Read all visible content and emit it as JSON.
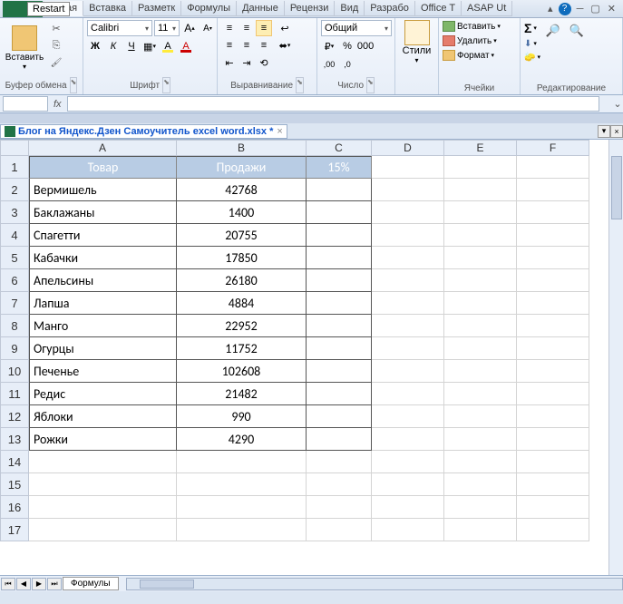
{
  "restart": "Restart",
  "tabs": [
    "авная",
    "Вставка",
    "Разметк",
    "Формулы",
    "Данные",
    "Рецензи",
    "Вид",
    "Разрабо",
    "Office T",
    "ASAP Ut"
  ],
  "ribbon": {
    "clipboard": {
      "paste": "Вставить",
      "label": "Буфер обмена"
    },
    "font": {
      "name": "Calibri",
      "size": "11",
      "label": "Шрифт",
      "bold": "Ж",
      "italic": "К",
      "underline": "Ч",
      "grow": "A",
      "shrink": "A"
    },
    "align": {
      "label": "Выравнивание",
      "wrap": "≡",
      "merge": "⬌"
    },
    "number": {
      "format": "Общий",
      "label": "Число"
    },
    "styles": {
      "label": "Стили"
    },
    "cells": {
      "insert": "Вставить",
      "delete": "Удалить",
      "format": "Формат",
      "label": "Ячейки"
    },
    "editing": {
      "label": "Редактирование"
    }
  },
  "formula_bar": {
    "fx": "fx"
  },
  "doc_tab": "Блог на Яндекс.Дзен Самоучитель excel word.xlsx *",
  "columns": [
    "A",
    "B",
    "C",
    "D",
    "E",
    "F"
  ],
  "col_widths": {
    "A": 163,
    "B": 143,
    "C": 72
  },
  "headers": {
    "A": "Товар",
    "B": "Продажи",
    "C": "15%"
  },
  "rows": [
    {
      "A": "Вермишель",
      "B": "42768"
    },
    {
      "A": "Баклажаны",
      "B": "1400"
    },
    {
      "A": "Спагетти",
      "B": "20755"
    },
    {
      "A": "Кабачки",
      "B": "17850"
    },
    {
      "A": "Апельсины",
      "B": "26180"
    },
    {
      "A": "Лапша",
      "B": "4884"
    },
    {
      "A": "Манго",
      "B": "22952"
    },
    {
      "A": "Огурцы",
      "B": "11752"
    },
    {
      "A": "Печенье",
      "B": "102608"
    },
    {
      "A": "Редис",
      "B": "21482"
    },
    {
      "A": "Яблоки",
      "B": "990"
    },
    {
      "A": "Рожки",
      "B": "4290"
    }
  ],
  "visible_rows": 17,
  "sheet_tab": "Формулы"
}
